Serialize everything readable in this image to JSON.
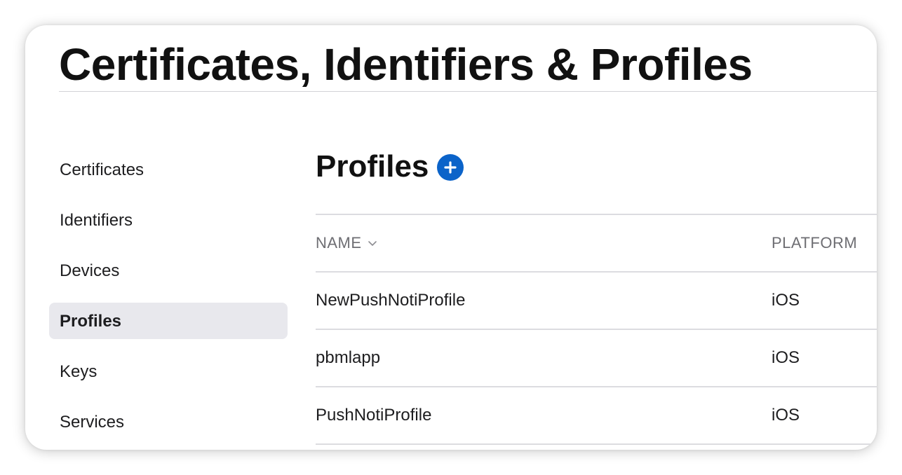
{
  "page": {
    "title": "Certificates, Identifiers & Profiles"
  },
  "sidebar": {
    "items": [
      {
        "label": "Certificates",
        "active": false
      },
      {
        "label": "Identifiers",
        "active": false
      },
      {
        "label": "Devices",
        "active": false
      },
      {
        "label": "Profiles",
        "active": true
      },
      {
        "label": "Keys",
        "active": false
      },
      {
        "label": "Services",
        "active": false
      }
    ]
  },
  "main": {
    "section_title": "Profiles",
    "add_icon": "plus-circle-icon",
    "table": {
      "columns": [
        {
          "label": "NAME",
          "sort_icon": "chevron-down-icon"
        },
        {
          "label": "PLATFORM"
        }
      ],
      "rows": [
        {
          "name": "NewPushNotiProfile",
          "platform": "iOS"
        },
        {
          "name": "pbmlapp",
          "platform": "iOS"
        },
        {
          "name": "PushNotiProfile",
          "platform": "iOS"
        }
      ]
    }
  },
  "colors": {
    "accent": "#0b63c9",
    "sidebar_active_bg": "#e8e8ed",
    "divider": "#dcdce0",
    "header_text": "#6e6e73"
  }
}
